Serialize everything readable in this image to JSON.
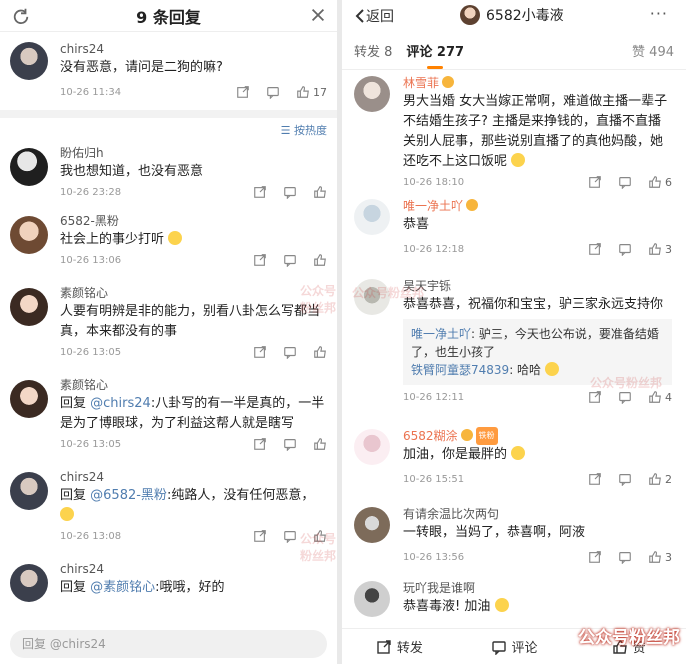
{
  "left": {
    "title": "9 条回复",
    "sort_label": "按热度",
    "reply_placeholder": "回复 @chirs24",
    "top_comment": {
      "name": "chirs24",
      "text": "没有恶意，请问是二狗的嘛?",
      "time": "10-26 11:34",
      "likes": "17"
    },
    "replies": [
      {
        "name": "盼佑归h",
        "text": "我也想知道，也没有恶意",
        "time": "10-26 23:28"
      },
      {
        "name": "6582-黑粉",
        "text": "社会上的事少打听",
        "time": "10-26 13:06"
      },
      {
        "name": "素颜铭心",
        "text": "人要有明辨是非的能力，别看八卦怎么写都当真，本来都没有的事",
        "time": "10-26 13:05"
      },
      {
        "name": "素颜铭心",
        "prefix": "回复",
        "mention": "@chirs24",
        "text": ":八卦写的有一半是真的，一半是为了博眼球，为了利益这帮人就是瞎写",
        "time": "10-26 13:05"
      },
      {
        "name": "chirs24",
        "prefix": "回复",
        "mention": "@6582-黑粉",
        "text": ":纯路人，没有任何恶意，",
        "time": "10-26 13:08"
      },
      {
        "name": "chirs24",
        "prefix": "回复",
        "mention": "@素颜铭心",
        "text": ":哦哦，好的"
      }
    ]
  },
  "right": {
    "back_label": "返回",
    "page_title": "6582小毒液",
    "more": "···",
    "tabs": {
      "repost": "转发 8",
      "comments": "评论 277",
      "likes": "赞 494"
    },
    "comments": [
      {
        "name": "林雪菲",
        "text": "男大当婚 女大当嫁正常啊，难道做主播一辈子不结婚生孩子? 主播是来挣钱的，直播不直播关别人屁事，那些说别直播了的真他妈酸，她还吃不上这口饭呢",
        "time": "10-26 18:10",
        "likes": "6"
      },
      {
        "name": "唯一净土吖",
        "text": "恭喜",
        "time": "10-26 12:18",
        "likes": "3"
      },
      {
        "name": "昊天宇铄",
        "text": "恭喜恭喜，祝福你和宝宝，驴三家永远支持你",
        "quote_author": "唯一净土吖",
        "quote_text": ": 驴三，今天也公布说，要准备结婚了，也生小孩了",
        "quote_author2": "铁臂阿童瑟74839",
        "quote_text2": ": 哈哈",
        "time": "10-26 12:11",
        "likes": "4"
      },
      {
        "name": "6582糊涂",
        "badge": "铁粉",
        "text": "加油，你是最胖的",
        "time": "10-26 15:51",
        "likes": "2"
      },
      {
        "name": "有请余温比次两句",
        "text": "一转眼，当妈了，恭喜啊，阿液",
        "time": "10-26 13:56",
        "likes": "3"
      },
      {
        "name": "玩吖我是谁啊",
        "text": "恭喜毒液! 加油"
      }
    ],
    "bottom": {
      "repost": "转发",
      "comment": "评论",
      "like": "赞"
    }
  },
  "watermark": "公众号粉丝邦"
}
